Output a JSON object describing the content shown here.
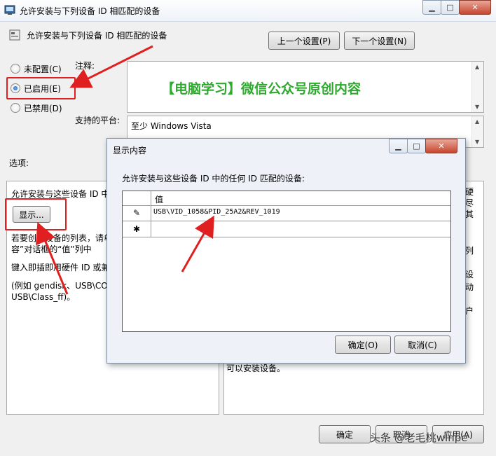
{
  "window": {
    "title": "允许安装与下列设备 ID 相匹配的设备",
    "heading": "允许安装与下列设备 ID 相匹配的设备",
    "controls": [
      "▁",
      "□",
      "✕"
    ]
  },
  "nav": {
    "prev_label": "上一个设置(P)",
    "next_label": "下一个设置(N)"
  },
  "radios": [
    {
      "label": "未配置(C)",
      "selected": false
    },
    {
      "label": "已启用(E)",
      "selected": true
    },
    {
      "label": "已禁用(D)",
      "selected": false
    }
  ],
  "comment": {
    "label": "注释:",
    "text": "【电脑学习】微信公众号原创内容"
  },
  "platform": {
    "label": "支持的平台:",
    "value": "至少 Windows Vista"
  },
  "options": {
    "label": "选项:",
    "desc": "允许安装与这些设备 ID 中",
    "show_button": "显示...",
    "help1": "若要创建设备的列表，请单",
    "help1b": "容”对话框的“值”列中",
    "help2": "键入即插即用硬件 ID 或兼",
    "help3": "(例如 gendisk、USB\\CO",
    "help3b": "USB\\Class_ff)。"
  },
  "help_right": {
    "chars": [
      "硬",
      "尽",
      "其",
      "列",
      "设",
      "动",
      "户"
    ],
    "tail": "可以安装设备。"
  },
  "dialog": {
    "title": "显示内容",
    "prompt": "允许安装与这些设备 ID 中的任何 ID 匹配的设备:",
    "column": "值",
    "rows": [
      {
        "marker": "✎",
        "value": "USB\\VID_1058&PID_25A2&REV_1019"
      },
      {
        "marker": "✱",
        "value": ""
      }
    ],
    "ok": "确定(O)",
    "cancel": "取消(C)"
  },
  "footer": {
    "ok": "确定",
    "cancel": "取消",
    "apply": "应用(A)"
  },
  "watermark": "头条 @老毛桃winpe"
}
